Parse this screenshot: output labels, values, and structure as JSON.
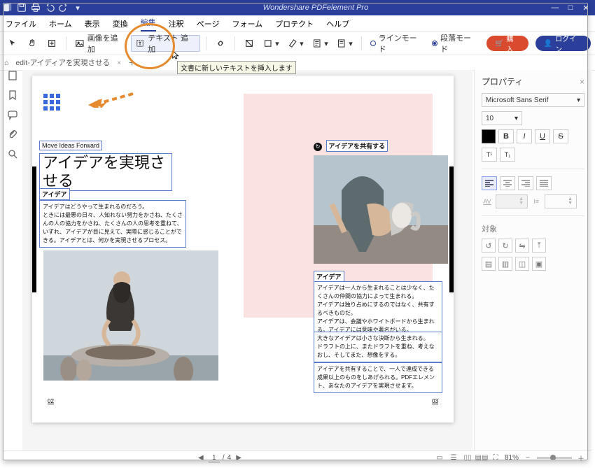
{
  "app_title": "Wondershare PDFelement Pro",
  "menu": {
    "items": [
      "ファイル",
      "ホーム",
      "表示",
      "変換",
      "編集",
      "注釈",
      "ページ",
      "フォーム",
      "プロテクト",
      "ヘルプ"
    ],
    "active_index": 4
  },
  "toolbar": {
    "add_image": "画像を追加",
    "text_add": "テキスト 追加",
    "line_mode": "ラインモード",
    "para_mode": "段落モード",
    "para_mode_selected": true,
    "buy": "購入",
    "login": "ログイン",
    "tooltip": "文書に新しいテキストを挿入します"
  },
  "tabs": {
    "open_doc": "edit-アイディアを実現させる"
  },
  "properties": {
    "title": "プロパティ",
    "font_family": "Microsoft Sans Serif",
    "font_size": "10",
    "target_label": "対象"
  },
  "document": {
    "sub_en": "Move Ideas Forward",
    "sub_jp": "アイデアを実現させる",
    "section1_title": "アイデア",
    "section1_body": "アイデアはどうやって生まれるのだろう。\nときには最悪の日々、人知れない努力をかさね、たくさんの人の協力をかさね、たくさんの人の思考を重ねて、いずれ、アイデアが目に見えて、実際に感じることができる。アイデアとは、何かを実現させるプロセス。",
    "share_label": "アイデアを共有する",
    "section2_title": "アイデア",
    "section2_body1": "アイデアは一人から生まれることは少なく、たくさんの仲間の協力によって生まれる。\nアイデアは独り占めにするのではなく、共有するべきものだ。\nアイデアは、会議やホワイトボードから生まれる。アイデアには意味や著名がいる。",
    "section2_body2": "大きなアイデアは小さな決断から生まれる。\nドラフトの上に、またドラフトを重ね、考えなおし、そしてまた、想像をする。",
    "section2_body3": "アイデアを共有することで、一人で達成できる成果以上のものをしあげられる。PDFエレメント、あなたのアイデアを実現させます。",
    "page_left_num": "02",
    "page_right_num": "03"
  },
  "status": {
    "page_current": "1",
    "page_total": "4",
    "zoom": "81%"
  },
  "icons": {
    "save": "save",
    "print": "print",
    "undo": "undo",
    "redo": "redo"
  }
}
